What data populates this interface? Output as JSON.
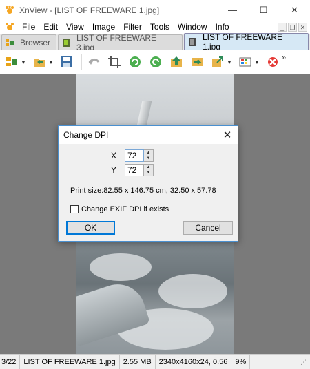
{
  "window": {
    "title": "XnView - [LIST OF FREEWARE 1.jpg]",
    "controls": {
      "minimize": "—",
      "maximize": "☐",
      "close": "✕"
    }
  },
  "menu": {
    "items": [
      "File",
      "Edit",
      "View",
      "Image",
      "Filter",
      "Tools",
      "Window",
      "Info"
    ],
    "mdi": {
      "minimize": "_",
      "restore": "❐",
      "close": "✕"
    }
  },
  "tabs": [
    {
      "label": "Browser",
      "active": false
    },
    {
      "label": "LIST OF FREEWARE 3.jpg",
      "active": false
    },
    {
      "label": "LIST OF FREEWARE 1.jpg",
      "active": true
    }
  ],
  "toolbar": {
    "overflow": "»",
    "icons": [
      "browser-icon",
      "open-folder-icon",
      "save-icon",
      "undo-icon",
      "crop-icon",
      "rotate-left-icon",
      "rotate-right-icon",
      "previous-image-icon",
      "next-image-icon",
      "export-icon",
      "palette-icon",
      "delete-icon"
    ]
  },
  "dialog": {
    "title": "Change DPI",
    "close": "✕",
    "x_label": "X",
    "x_value": "72",
    "y_label": "Y",
    "y_value": "72",
    "print_size": "Print size:82.55 x 146.75 cm, 32.50 x 57.78",
    "checkbox_label": "Change EXIF DPI if exists",
    "checkbox_checked": false,
    "ok_label": "OK",
    "cancel_label": "Cancel"
  },
  "status": {
    "index": "3/22",
    "filename": "LIST OF FREEWARE 1.jpg",
    "filesize": "2.55 MB",
    "dimensions": "2340x4160x24, 0.56",
    "zoom": "9%"
  },
  "colors": {
    "accent": "#0078d7",
    "canvas": "#7a7a7a",
    "active_tab": "#d6e8f5"
  }
}
